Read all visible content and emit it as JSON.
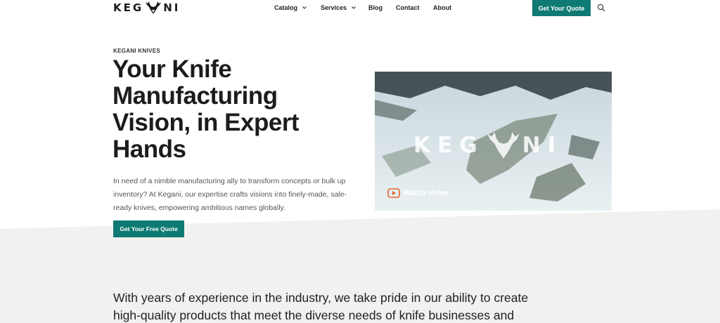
{
  "brand": {
    "logo_left": "KEG",
    "logo_right": "NI"
  },
  "nav": {
    "items": [
      {
        "label": "Catalog",
        "has_dropdown": true
      },
      {
        "label": "Services",
        "has_dropdown": true
      },
      {
        "label": "Blog",
        "has_dropdown": false
      },
      {
        "label": "Contact",
        "has_dropdown": false
      },
      {
        "label": "About",
        "has_dropdown": false
      }
    ],
    "quote_label": "Get Your Quote",
    "search_icon": "search-icon"
  },
  "hero": {
    "eyebrow": "KEGANI KNIVES",
    "title": "Your Knife Manufacturing Vision, in Expert Hands",
    "description": "In need of a nimble manufacturing ally to transform concepts or bulk up inventory? At Kegani, our expertise crafts visions into finely-made, sale-ready knives, empowering ambitious names globally.",
    "cta_label": "Get Your Free Quote"
  },
  "video": {
    "overlay_left": "KEG",
    "overlay_right": "NI",
    "watch_label": "Watch Video",
    "play_icon": "play-icon"
  },
  "intro": {
    "text": "With years of experience in the industry, we take pride in our ability to create high-quality products that meet the diverse needs of knife businesses and"
  },
  "colors": {
    "accent": "#0e7a73",
    "band": "#f1f1ef",
    "play_icon": "#e0662c"
  }
}
